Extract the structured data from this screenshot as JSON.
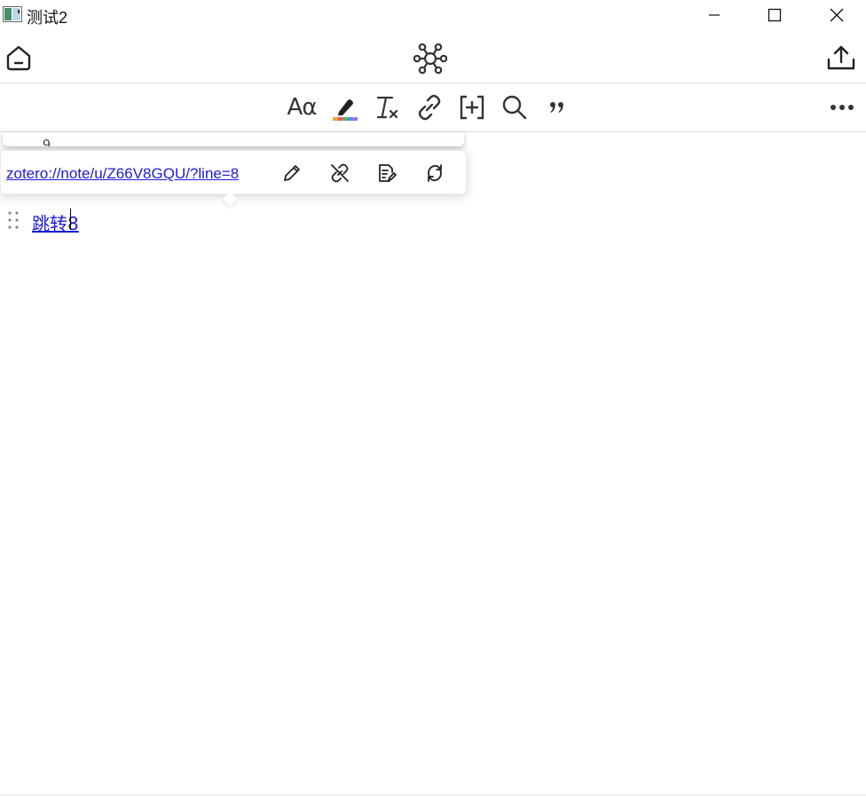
{
  "window": {
    "title": "测试2"
  },
  "icons": {
    "home": "home-icon",
    "graph": "graph-network-icon",
    "export": "export-upload-icon",
    "minimize": "minimize-icon",
    "maximize": "maximize-icon",
    "close": "close-icon"
  },
  "format_toolbar": {
    "text_format_label": "Aα",
    "items": [
      "text-format",
      "highlight",
      "clear-format",
      "link",
      "insert-citation",
      "find",
      "quote",
      "more"
    ]
  },
  "colors": {
    "link": "#1b1bd6",
    "icon": "#333333",
    "highlight_stripes": [
      "#e8a540",
      "#e85a5a",
      "#5ab35a",
      "#4a8fe0",
      "#a870d8"
    ]
  },
  "editor": {
    "previous_popup_text": "9",
    "link_popup": {
      "url": "zotero://note/u/Z66V8GQU/?line=8",
      "actions": [
        "edit-link",
        "unlink",
        "open-note",
        "refresh-link"
      ]
    },
    "line_text_before_caret": "跳转",
    "line_text_after_caret": "8"
  }
}
